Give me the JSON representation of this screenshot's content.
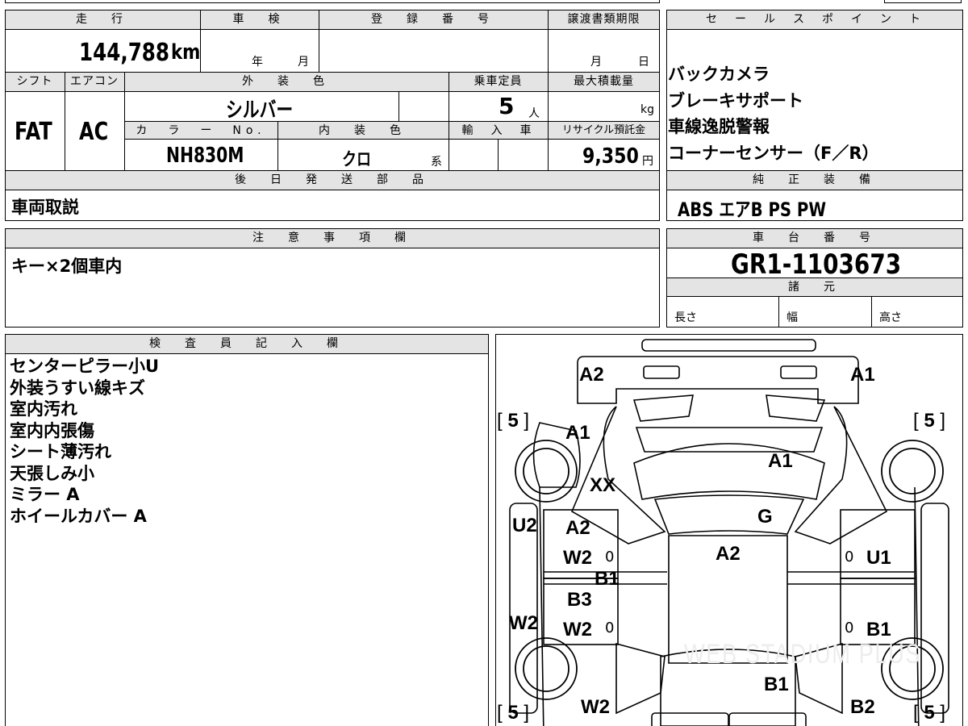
{
  "vehicle": {
    "headers": {
      "mileage": "走　行",
      "inspection": "車　検",
      "registration": "登　録　番　号",
      "transfer_deadline": "譲渡書類期限",
      "shift": "シフト",
      "ac": "エアコン",
      "exterior_color": "外　装　色",
      "capacity": "乗車定員",
      "max_load": "最大積載量",
      "color_no": "カ　ラ　ー　No.",
      "interior_color": "内　装　色",
      "import": "輸　入　車",
      "recycle": "リサイクル預託金",
      "later_parts": "後　日　発　送　部　品"
    },
    "mileage": "144,788",
    "mileage_unit": "km",
    "inspection_year_unit": "年",
    "inspection_month_unit": "月",
    "deadline_month_unit": "月",
    "deadline_day_unit": "日",
    "shift": "FAT",
    "ac": "AC",
    "exterior_color": "シルバー",
    "capacity": "5",
    "capacity_unit": "人",
    "max_load_unit": "kg",
    "color_no": "NH830M",
    "interior_color": "クロ",
    "interior_suffix": "系",
    "recycle_fee": "9,350",
    "recycle_unit": "円",
    "later_parts": "車両取説"
  },
  "sales_points": {
    "header": "セ　ー　ル　ス　ポ　イ　ン　ト",
    "items": [
      "バックカメラ",
      "ブレーキサポート",
      "車線逸脱警報",
      "コーナーセンサー（F／R）"
    ]
  },
  "genuine_equipment": {
    "header": "純　正　装　備",
    "items": "ABS エアB PS PW"
  },
  "notes": {
    "header": "注　意　事　項　欄",
    "text": "キー×2個車内"
  },
  "chassis": {
    "header": "車　台　番　号",
    "number": "GR1-1103673",
    "spec_header": "諸　元",
    "length": "長さ",
    "width": "幅",
    "height": "高さ"
  },
  "inspector": {
    "header": "検　査　員　記　入　欄",
    "items": [
      "センターピラー小U",
      "外装うすい線キズ",
      "室内汚れ",
      "室内内張傷",
      "シート薄汚れ",
      "天張しみ小",
      "ミラー A",
      "ホイールカバー A"
    ]
  },
  "diagram": {
    "marks": {
      "rear_left": "A2",
      "rear_right": "A1",
      "rear_hatch": "A1",
      "left_quarter": "A1",
      "left_pillar": "XX",
      "rear_glass": "G",
      "roof": "A2",
      "left_door_top": "A2",
      "left_door_top2": "W2",
      "left_mid": "B1",
      "left_door_bot": "B3",
      "left_door_bot2": "W2",
      "left_rocker_top": "U2",
      "left_rocker_bot": "W2",
      "right_door_top": "U1",
      "right_door_bot": "B1",
      "hood": "B1",
      "front_left": "W2",
      "front_right": "B2"
    },
    "tires": [
      "5",
      "5",
      "5",
      "5"
    ],
    "tire_brackets": {
      "open": "[",
      "close": "]"
    },
    "zeros": [
      "0",
      "0",
      "0",
      "0"
    ],
    "watermark": "WEB STADIUM PLUS"
  }
}
